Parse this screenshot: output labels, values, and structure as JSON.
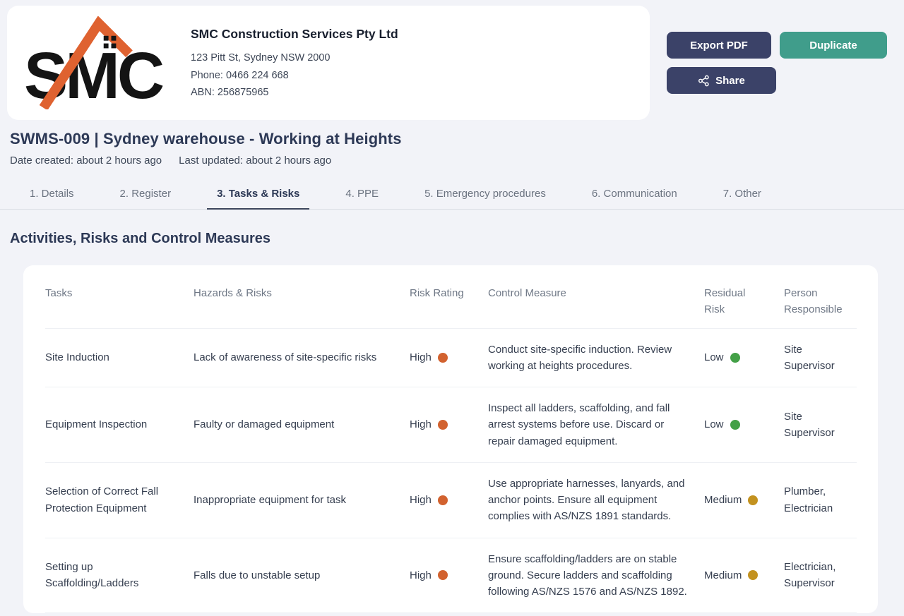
{
  "header": {
    "logo_text": "SMC",
    "company_name": "SMC Construction Services Pty Ltd",
    "address": "123 Pitt St, Sydney NSW 2000",
    "phone": "Phone: 0466 224 668",
    "abn": "ABN: 256875965"
  },
  "actions": {
    "export_pdf": "Export PDF",
    "duplicate": "Duplicate",
    "share": "Share"
  },
  "document": {
    "title": "SWMS-009 | Sydney warehouse - Working at Heights",
    "date_created": "Date created: about 2 hours ago",
    "last_updated": "Last updated: about 2 hours ago"
  },
  "tabs": [
    {
      "label": "1. Details",
      "active": false
    },
    {
      "label": "2. Register",
      "active": false
    },
    {
      "label": "3. Tasks & Risks",
      "active": true
    },
    {
      "label": "4. PPE",
      "active": false
    },
    {
      "label": "5. Emergency procedures",
      "active": false
    },
    {
      "label": "6. Communication",
      "active": false
    },
    {
      "label": "7. Other",
      "active": false
    }
  ],
  "section": {
    "heading": "Activities, Risks and Control Measures"
  },
  "colors": {
    "accent_navy": "#3b4268",
    "accent_teal": "#409d8b",
    "risk_high": "#d2622f",
    "risk_medium": "#c3921f",
    "risk_low": "#43a047",
    "logo_orange": "#df6230",
    "logo_black": "#141414"
  },
  "table": {
    "columns": [
      "Tasks",
      "Hazards & Risks",
      "Risk Rating",
      "Control Measure",
      "Residual Risk",
      "Person Responsible"
    ],
    "rows": [
      {
        "task": "Site Induction",
        "hazard": "Lack of awareness of site-specific risks",
        "risk_rating": "High",
        "risk_color": "#d2622f",
        "control_measure": "Conduct site-specific induction. Review working at heights procedures.",
        "residual_risk": "Low",
        "residual_color": "#43a047",
        "person": "Site Supervisor"
      },
      {
        "task": "Equipment Inspection",
        "hazard": "Faulty or damaged equipment",
        "risk_rating": "High",
        "risk_color": "#d2622f",
        "control_measure": "Inspect all ladders, scaffolding, and fall arrest systems before use. Discard or repair damaged equipment.",
        "residual_risk": "Low",
        "residual_color": "#43a047",
        "person": "Site Supervisor"
      },
      {
        "task": "Selection of Correct Fall Protection Equipment",
        "hazard": "Inappropriate equipment for task",
        "risk_rating": "High",
        "risk_color": "#d2622f",
        "control_measure": "Use appropriate harnesses, lanyards, and anchor points. Ensure all equipment complies with AS/NZS 1891 standards.",
        "residual_risk": "Medium",
        "residual_color": "#c3921f",
        "person": "Plumber, Electrician"
      },
      {
        "task": "Setting up Scaffolding/Ladders",
        "hazard": "Falls due to unstable setup",
        "risk_rating": "High",
        "risk_color": "#d2622f",
        "control_measure": "Ensure scaffolding/ladders are on stable ground. Secure ladders and scaffolding following AS/NZS 1576 and AS/NZS 1892.",
        "residual_risk": "Medium",
        "residual_color": "#c3921f",
        "person": "Electrician, Supervisor"
      }
    ]
  }
}
